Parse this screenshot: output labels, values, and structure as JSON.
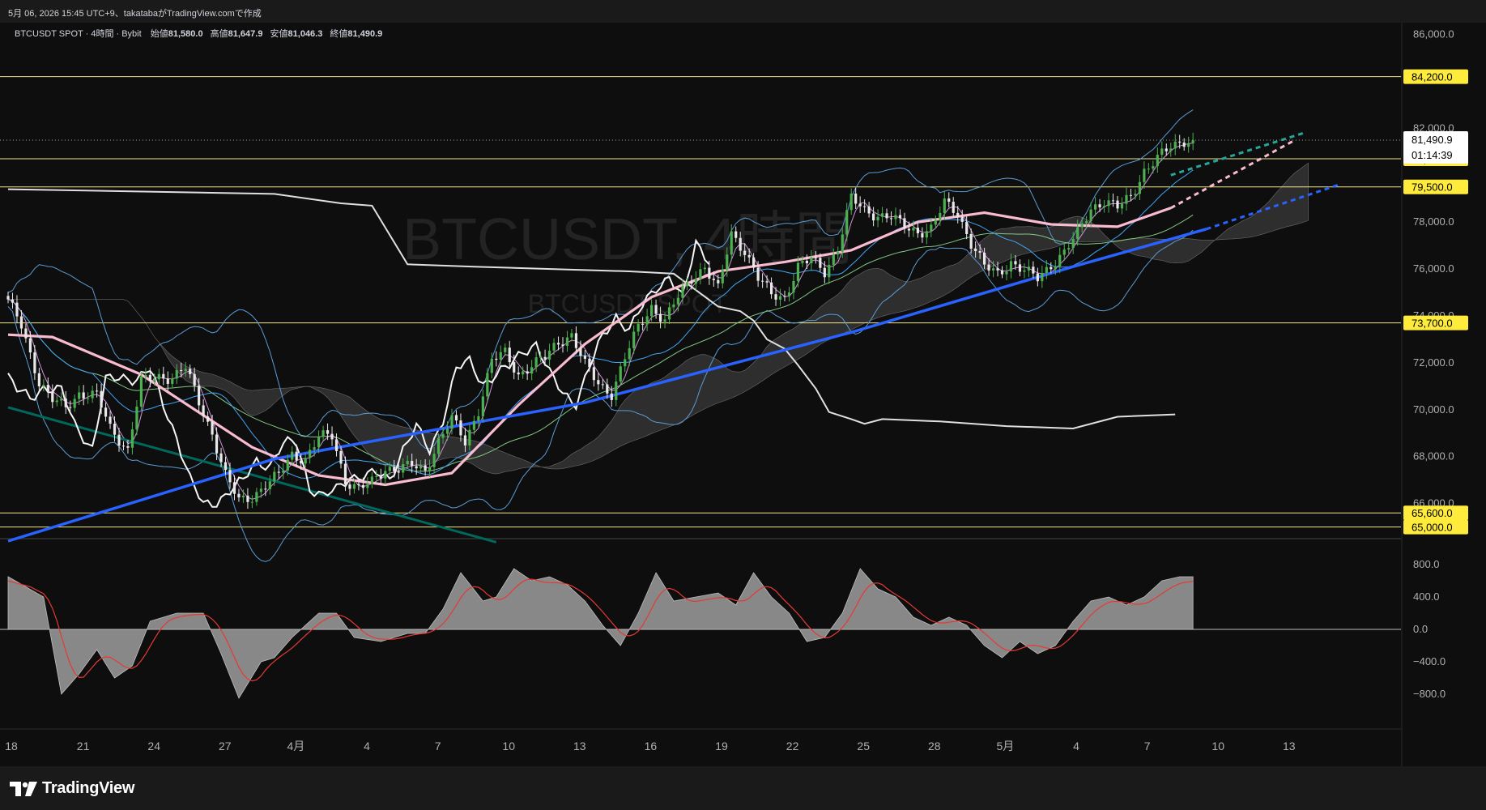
{
  "header": {
    "caption": "5月 06, 2026 15:45 UTC+9、takatabaがTradingView.comで作成"
  },
  "legend": {
    "symbol": "BTCUSDT SPOT · 4時間 · Bybit",
    "open_label": "始値",
    "open": "81,580.0",
    "high_label": "高値",
    "high": "81,647.9",
    "low_label": "安値",
    "low": "81,046.3",
    "close_label": "終値",
    "close": "81,490.9"
  },
  "watermark": {
    "title": "BTCUSDT, 4時間",
    "subtitle": "BTCUSDT SPOT"
  },
  "price_axis": {
    "ticks": [
      "86,000.0",
      "82,000.0",
      "78,000.0",
      "76,000.0",
      "74,000.0",
      "72,000.0",
      "70,000.0",
      "68,000.0",
      "66,000.0"
    ],
    "price_label": "81,490.9",
    "countdown": "01:14:39",
    "level_labels": [
      "84,200.0",
      "80,700.0",
      "79,500.0",
      "73,700.0",
      "65,600.0",
      "65,000.0"
    ]
  },
  "osc_axis": {
    "ticks": [
      "800.0",
      "400.0",
      "0.0",
      "−400.0",
      "−800.0"
    ]
  },
  "time_axis": {
    "labels": [
      "18",
      "21",
      "24",
      "27",
      "4月",
      "4",
      "7",
      "10",
      "13",
      "16",
      "19",
      "22",
      "25",
      "28",
      "5月",
      "4",
      "7",
      "10",
      "13"
    ]
  },
  "footer": {
    "brand": "TradingView"
  },
  "colors": {
    "background": "#0e0e0e",
    "bull_candle": "#4caf50",
    "bear_candle": "#e8e8e8",
    "level_line": "#f0e68c",
    "level_badge": "#ffeb3b",
    "ema200": "#2962ff",
    "ma_pink": "#f8bbd0",
    "bollinger": "#5b9bd5",
    "cloud": "#3a3a3a",
    "oscillator_fill": "#9e9e9e",
    "signal": "#e53935"
  },
  "chart_data": {
    "type": "candlestick",
    "title": "BTCUSDT SPOT · 4時間 · Bybit",
    "ylim": [
      64400,
      86500
    ],
    "last_price": 81490.9,
    "horizontal_levels": [
      84200,
      80700,
      79500,
      73700,
      65600,
      65000
    ],
    "x_labels": [
      "18",
      "21",
      "24",
      "27",
      "4月",
      "4",
      "7",
      "10",
      "13",
      "16",
      "19",
      "22",
      "25",
      "28",
      "5月",
      "4",
      "7",
      "10",
      "13"
    ],
    "close_path": [
      [
        0,
        74600
      ],
      [
        3,
        73600
      ],
      [
        7,
        71200
      ],
      [
        10,
        70400
      ],
      [
        13,
        70100
      ],
      [
        16,
        70700
      ],
      [
        20,
        70600
      ],
      [
        23,
        69200
      ],
      [
        27,
        68300
      ],
      [
        30,
        71200
      ],
      [
        34,
        71400
      ],
      [
        37,
        71400
      ],
      [
        40,
        71800
      ],
      [
        43,
        70300
      ],
      [
        46,
        69000
      ],
      [
        49,
        67200
      ],
      [
        52,
        66100
      ],
      [
        55,
        66300
      ],
      [
        58,
        66800
      ],
      [
        61,
        67200
      ],
      [
        64,
        68100
      ],
      [
        67,
        67900
      ],
      [
        70,
        68800
      ],
      [
        73,
        68900
      ],
      [
        76,
        67000
      ],
      [
        79,
        66600
      ],
      [
        82,
        66900
      ],
      [
        85,
        67500
      ],
      [
        88,
        67500
      ],
      [
        91,
        67600
      ],
      [
        94,
        67400
      ],
      [
        97,
        68700
      ],
      [
        100,
        69600
      ],
      [
        103,
        68600
      ],
      [
        106,
        70000
      ],
      [
        109,
        72100
      ],
      [
        112,
        72400
      ],
      [
        115,
        71500
      ],
      [
        118,
        71900
      ],
      [
        121,
        72200
      ],
      [
        124,
        72900
      ],
      [
        127,
        73200
      ],
      [
        130,
        71900
      ],
      [
        133,
        71100
      ],
      [
        136,
        70700
      ],
      [
        139,
        72200
      ],
      [
        142,
        73500
      ],
      [
        145,
        74400
      ],
      [
        148,
        73800
      ],
      [
        151,
        74800
      ],
      [
        154,
        75600
      ],
      [
        157,
        76100
      ],
      [
        160,
        75100
      ],
      [
        163,
        77500
      ],
      [
        166,
        76800
      ],
      [
        169,
        75600
      ],
      [
        172,
        74900
      ],
      [
        175,
        74800
      ],
      [
        178,
        76100
      ],
      [
        181,
        76400
      ],
      [
        184,
        75900
      ],
      [
        187,
        76900
      ],
      [
        190,
        79000
      ],
      [
        193,
        78500
      ],
      [
        196,
        78300
      ],
      [
        199,
        78200
      ],
      [
        202,
        77800
      ],
      [
        205,
        77600
      ],
      [
        208,
        77700
      ],
      [
        211,
        78800
      ],
      [
        214,
        78400
      ],
      [
        217,
        77100
      ],
      [
        220,
        76100
      ],
      [
        223,
        75800
      ],
      [
        226,
        76300
      ],
      [
        229,
        75900
      ],
      [
        232,
        75600
      ],
      [
        235,
        76200
      ],
      [
        238,
        76700
      ],
      [
        241,
        77500
      ],
      [
        244,
        78600
      ],
      [
        247,
        78900
      ],
      [
        250,
        78600
      ],
      [
        253,
        79100
      ],
      [
        256,
        80200
      ],
      [
        259,
        80700
      ],
      [
        262,
        81200
      ],
      [
        265,
        81500
      ],
      [
        267,
        81490
      ]
    ],
    "ema200": [
      [
        0,
        64400
      ],
      [
        60,
        67900
      ],
      [
        130,
        70300
      ],
      [
        190,
        73300
      ],
      [
        240,
        76100
      ],
      [
        270,
        77700
      ]
    ],
    "ema200_projection": [
      [
        270,
        77700
      ],
      [
        300,
        79600
      ]
    ],
    "ma_pink": [
      [
        0,
        73200
      ],
      [
        10,
        73100
      ],
      [
        30,
        71500
      ],
      [
        55,
        68400
      ],
      [
        70,
        67200
      ],
      [
        85,
        66800
      ],
      [
        100,
        67300
      ],
      [
        115,
        70200
      ],
      [
        130,
        72800
      ],
      [
        145,
        74800
      ],
      [
        160,
        75900
      ],
      [
        175,
        76300
      ],
      [
        190,
        76800
      ],
      [
        205,
        78000
      ],
      [
        220,
        78400
      ],
      [
        235,
        77900
      ],
      [
        250,
        77800
      ],
      [
        262,
        78600
      ]
    ],
    "ma_pink_projection": [
      [
        262,
        78600
      ],
      [
        290,
        81500
      ]
    ],
    "baseline_white": [
      [
        0,
        79400
      ],
      [
        60,
        79200
      ],
      [
        75,
        78800
      ],
      [
        82,
        78700
      ],
      [
        90,
        76200
      ],
      [
        105,
        76100
      ],
      [
        140,
        75900
      ],
      [
        150,
        75800
      ],
      [
        160,
        74400
      ],
      [
        165,
        74200
      ],
      [
        168,
        73800
      ],
      [
        171,
        73000
      ],
      [
        175,
        72600
      ],
      [
        178,
        71900
      ],
      [
        182,
        70900
      ],
      [
        185,
        69900
      ],
      [
        190,
        69600
      ],
      [
        193,
        69400
      ],
      [
        197,
        69600
      ],
      [
        210,
        69500
      ],
      [
        225,
        69300
      ],
      [
        240,
        69200
      ],
      [
        250,
        69700
      ],
      [
        263,
        69800
      ]
    ],
    "osc_histogram": [
      [
        0,
        650
      ],
      [
        8,
        400
      ],
      [
        12,
        -800
      ],
      [
        16,
        -550
      ],
      [
        20,
        -250
      ],
      [
        24,
        -600
      ],
      [
        28,
        -450
      ],
      [
        32,
        100
      ],
      [
        38,
        200
      ],
      [
        44,
        200
      ],
      [
        48,
        -300
      ],
      [
        52,
        -850
      ],
      [
        57,
        -400
      ],
      [
        60,
        -350
      ],
      [
        64,
        -100
      ],
      [
        70,
        200
      ],
      [
        74,
        200
      ],
      [
        78,
        -100
      ],
      [
        84,
        -150
      ],
      [
        90,
        -50
      ],
      [
        94,
        -50
      ],
      [
        98,
        250
      ],
      [
        102,
        700
      ],
      [
        107,
        350
      ],
      [
        110,
        400
      ],
      [
        114,
        750
      ],
      [
        118,
        600
      ],
      [
        122,
        650
      ],
      [
        126,
        550
      ],
      [
        130,
        350
      ],
      [
        134,
        50
      ],
      [
        138,
        -200
      ],
      [
        142,
        200
      ],
      [
        146,
        700
      ],
      [
        150,
        350
      ],
      [
        155,
        400
      ],
      [
        160,
        450
      ],
      [
        164,
        300
      ],
      [
        168,
        700
      ],
      [
        172,
        400
      ],
      [
        176,
        200
      ],
      [
        180,
        -150
      ],
      [
        184,
        -100
      ],
      [
        188,
        200
      ],
      [
        192,
        750
      ],
      [
        196,
        500
      ],
      [
        200,
        400
      ],
      [
        204,
        150
      ],
      [
        208,
        50
      ],
      [
        212,
        150
      ],
      [
        216,
        50
      ],
      [
        220,
        -200
      ],
      [
        224,
        -350
      ],
      [
        228,
        -150
      ],
      [
        232,
        -300
      ],
      [
        236,
        -200
      ],
      [
        240,
        100
      ],
      [
        244,
        350
      ],
      [
        248,
        400
      ],
      [
        252,
        300
      ],
      [
        256,
        400
      ],
      [
        260,
        600
      ],
      [
        264,
        650
      ],
      [
        267,
        650
      ]
    ]
  }
}
